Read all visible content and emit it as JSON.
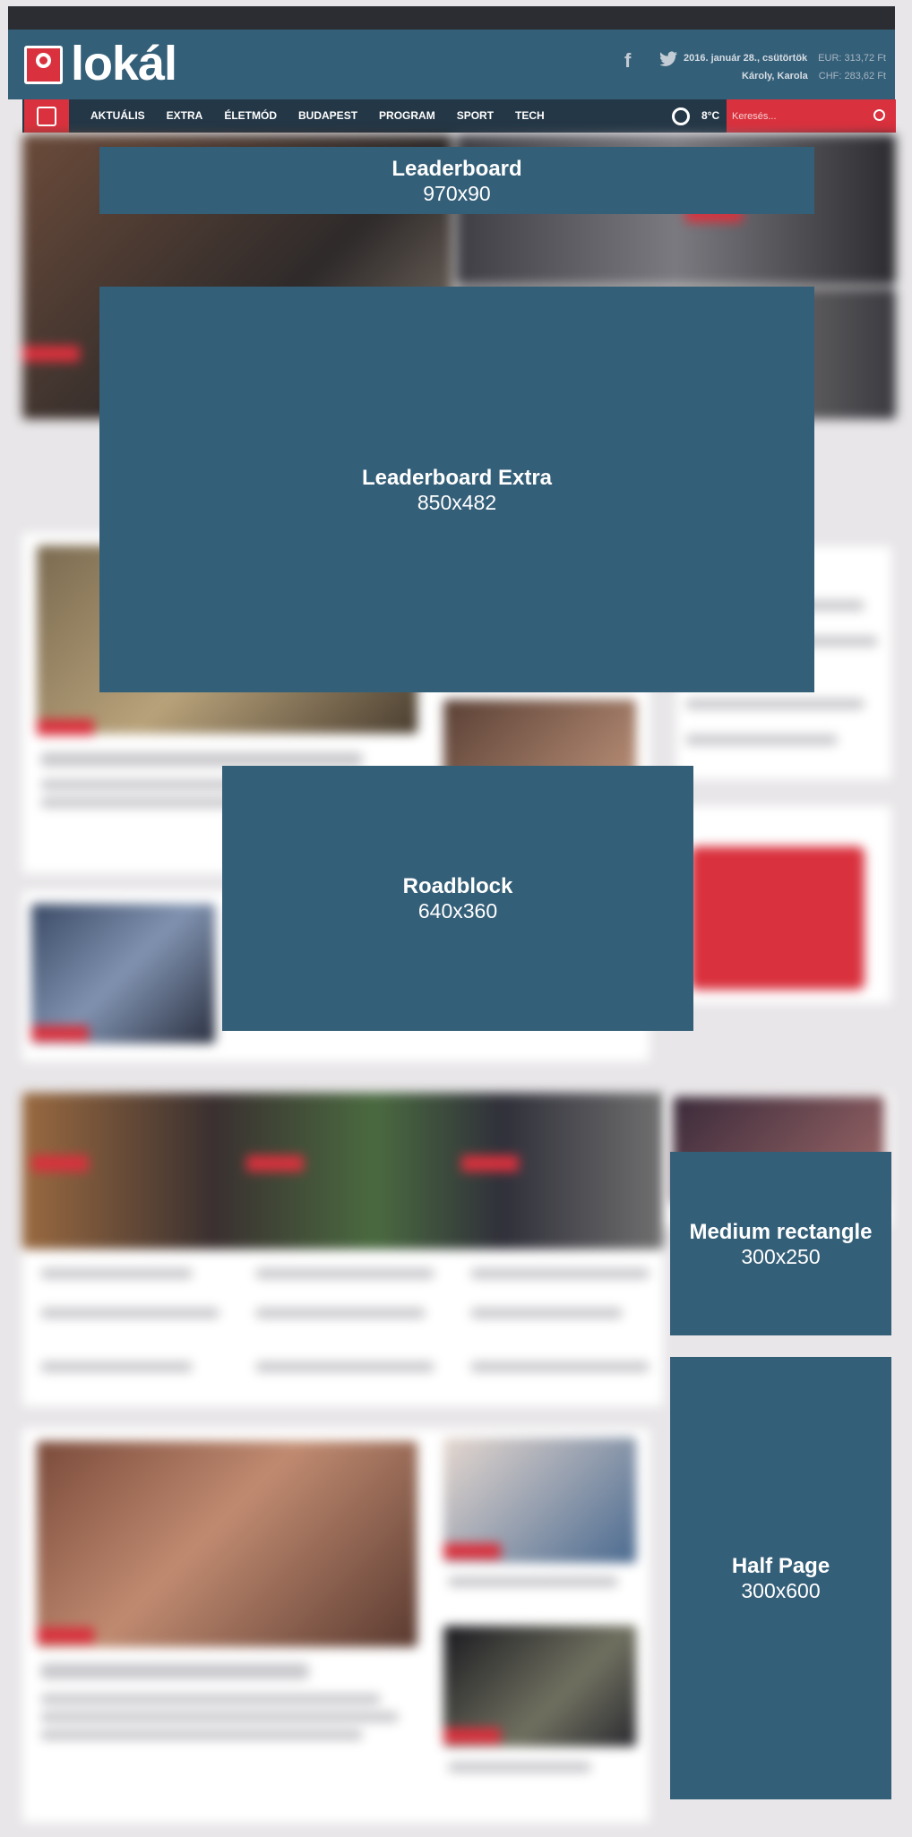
{
  "header": {
    "logo_text": "lokál",
    "social": {
      "facebook": "f",
      "twitter": "🐦"
    },
    "date": "2016. január 28., csütörtök",
    "eur": "EUR: 313,72 Ft",
    "nameday": "Károly, Karola",
    "chf": "CHF: 283,62 Ft"
  },
  "nav": {
    "items": [
      "AKTUÁLIS",
      "EXTRA",
      "ÉLETMÓD",
      "BUDAPEST",
      "PROGRAM",
      "SPORT",
      "TECH"
    ],
    "temperature": "8°C",
    "search_placeholder": "Keresés..."
  },
  "ads": {
    "leaderboard": {
      "name": "Leaderboard",
      "size": "970x90"
    },
    "leaderboard_extra": {
      "name": "Leaderboard Extra",
      "size": "850x482"
    },
    "roadblock": {
      "name": "Roadblock",
      "size": "640x360"
    },
    "medium_rectangle": {
      "name": "Medium rectangle",
      "size": "300x250"
    },
    "half_page": {
      "name": "Half Page",
      "size": "300x600"
    }
  },
  "colors": {
    "brand": "#345f78",
    "accent": "#d9313d",
    "nav": "#243746"
  }
}
